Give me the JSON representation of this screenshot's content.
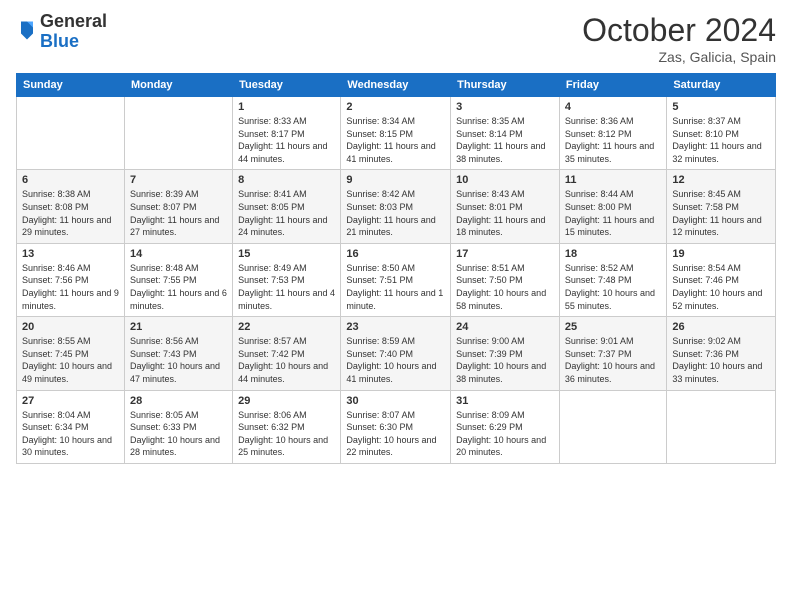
{
  "logo": {
    "general": "General",
    "blue": "Blue"
  },
  "title": "October 2024",
  "location": "Zas, Galicia, Spain",
  "days_of_week": [
    "Sunday",
    "Monday",
    "Tuesday",
    "Wednesday",
    "Thursday",
    "Friday",
    "Saturday"
  ],
  "weeks": [
    [
      {
        "day": "",
        "info": ""
      },
      {
        "day": "",
        "info": ""
      },
      {
        "day": "1",
        "info": "Sunrise: 8:33 AM\nSunset: 8:17 PM\nDaylight: 11 hours and 44 minutes."
      },
      {
        "day": "2",
        "info": "Sunrise: 8:34 AM\nSunset: 8:15 PM\nDaylight: 11 hours and 41 minutes."
      },
      {
        "day": "3",
        "info": "Sunrise: 8:35 AM\nSunset: 8:14 PM\nDaylight: 11 hours and 38 minutes."
      },
      {
        "day": "4",
        "info": "Sunrise: 8:36 AM\nSunset: 8:12 PM\nDaylight: 11 hours and 35 minutes."
      },
      {
        "day": "5",
        "info": "Sunrise: 8:37 AM\nSunset: 8:10 PM\nDaylight: 11 hours and 32 minutes."
      }
    ],
    [
      {
        "day": "6",
        "info": "Sunrise: 8:38 AM\nSunset: 8:08 PM\nDaylight: 11 hours and 29 minutes."
      },
      {
        "day": "7",
        "info": "Sunrise: 8:39 AM\nSunset: 8:07 PM\nDaylight: 11 hours and 27 minutes."
      },
      {
        "day": "8",
        "info": "Sunrise: 8:41 AM\nSunset: 8:05 PM\nDaylight: 11 hours and 24 minutes."
      },
      {
        "day": "9",
        "info": "Sunrise: 8:42 AM\nSunset: 8:03 PM\nDaylight: 11 hours and 21 minutes."
      },
      {
        "day": "10",
        "info": "Sunrise: 8:43 AM\nSunset: 8:01 PM\nDaylight: 11 hours and 18 minutes."
      },
      {
        "day": "11",
        "info": "Sunrise: 8:44 AM\nSunset: 8:00 PM\nDaylight: 11 hours and 15 minutes."
      },
      {
        "day": "12",
        "info": "Sunrise: 8:45 AM\nSunset: 7:58 PM\nDaylight: 11 hours and 12 minutes."
      }
    ],
    [
      {
        "day": "13",
        "info": "Sunrise: 8:46 AM\nSunset: 7:56 PM\nDaylight: 11 hours and 9 minutes."
      },
      {
        "day": "14",
        "info": "Sunrise: 8:48 AM\nSunset: 7:55 PM\nDaylight: 11 hours and 6 minutes."
      },
      {
        "day": "15",
        "info": "Sunrise: 8:49 AM\nSunset: 7:53 PM\nDaylight: 11 hours and 4 minutes."
      },
      {
        "day": "16",
        "info": "Sunrise: 8:50 AM\nSunset: 7:51 PM\nDaylight: 11 hours and 1 minute."
      },
      {
        "day": "17",
        "info": "Sunrise: 8:51 AM\nSunset: 7:50 PM\nDaylight: 10 hours and 58 minutes."
      },
      {
        "day": "18",
        "info": "Sunrise: 8:52 AM\nSunset: 7:48 PM\nDaylight: 10 hours and 55 minutes."
      },
      {
        "day": "19",
        "info": "Sunrise: 8:54 AM\nSunset: 7:46 PM\nDaylight: 10 hours and 52 minutes."
      }
    ],
    [
      {
        "day": "20",
        "info": "Sunrise: 8:55 AM\nSunset: 7:45 PM\nDaylight: 10 hours and 49 minutes."
      },
      {
        "day": "21",
        "info": "Sunrise: 8:56 AM\nSunset: 7:43 PM\nDaylight: 10 hours and 47 minutes."
      },
      {
        "day": "22",
        "info": "Sunrise: 8:57 AM\nSunset: 7:42 PM\nDaylight: 10 hours and 44 minutes."
      },
      {
        "day": "23",
        "info": "Sunrise: 8:59 AM\nSunset: 7:40 PM\nDaylight: 10 hours and 41 minutes."
      },
      {
        "day": "24",
        "info": "Sunrise: 9:00 AM\nSunset: 7:39 PM\nDaylight: 10 hours and 38 minutes."
      },
      {
        "day": "25",
        "info": "Sunrise: 9:01 AM\nSunset: 7:37 PM\nDaylight: 10 hours and 36 minutes."
      },
      {
        "day": "26",
        "info": "Sunrise: 9:02 AM\nSunset: 7:36 PM\nDaylight: 10 hours and 33 minutes."
      }
    ],
    [
      {
        "day": "27",
        "info": "Sunrise: 8:04 AM\nSunset: 6:34 PM\nDaylight: 10 hours and 30 minutes."
      },
      {
        "day": "28",
        "info": "Sunrise: 8:05 AM\nSunset: 6:33 PM\nDaylight: 10 hours and 28 minutes."
      },
      {
        "day": "29",
        "info": "Sunrise: 8:06 AM\nSunset: 6:32 PM\nDaylight: 10 hours and 25 minutes."
      },
      {
        "day": "30",
        "info": "Sunrise: 8:07 AM\nSunset: 6:30 PM\nDaylight: 10 hours and 22 minutes."
      },
      {
        "day": "31",
        "info": "Sunrise: 8:09 AM\nSunset: 6:29 PM\nDaylight: 10 hours and 20 minutes."
      },
      {
        "day": "",
        "info": ""
      },
      {
        "day": "",
        "info": ""
      }
    ]
  ]
}
